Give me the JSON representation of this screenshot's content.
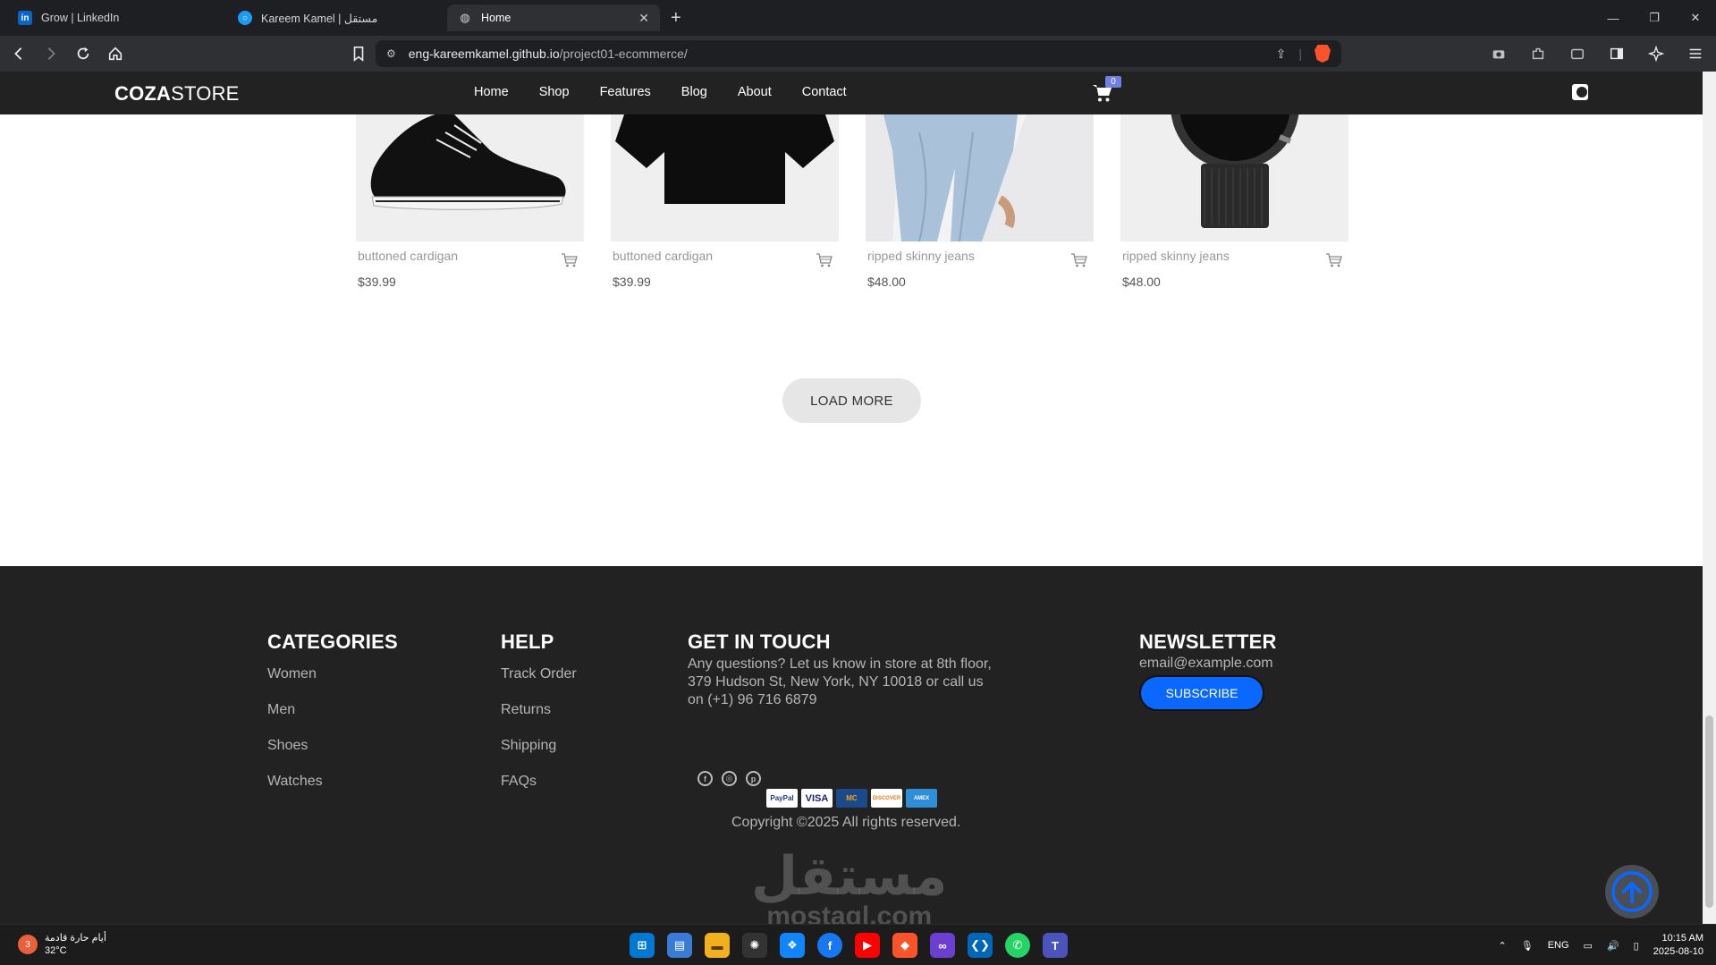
{
  "browser": {
    "tabs": [
      {
        "title": "Grow | LinkedIn",
        "icon": "linkedin-icon",
        "active": false
      },
      {
        "title": "Kareem Kamel | مستقل",
        "icon": "mostaql-icon",
        "active": false
      },
      {
        "title": "Home",
        "icon": "globe-icon",
        "active": true
      }
    ],
    "url_host": "eng-kareemkamel.github.io",
    "url_path": "/project01-ecommerce/"
  },
  "site": {
    "logo_bold": "COZA",
    "logo_rest": "STORE",
    "nav": [
      "Home",
      "Shop",
      "Features",
      "Blog",
      "About",
      "Contact"
    ],
    "cart_count": "0"
  },
  "products": [
    {
      "name": "buttoned cardigan",
      "price": "$39.99",
      "image": "sneaker"
    },
    {
      "name": "buttoned cardigan",
      "price": "$39.99",
      "image": "tshirt"
    },
    {
      "name": "ripped skinny jeans",
      "price": "$48.00",
      "image": "jeans"
    },
    {
      "name": "ripped skinny jeans",
      "price": "$48.00",
      "image": "watch"
    }
  ],
  "load_more": "LOAD MORE",
  "footer": {
    "categories": {
      "title": "CATEGORIES",
      "items": [
        "Women",
        "Men",
        "Shoes",
        "Watches"
      ]
    },
    "help": {
      "title": "HELP",
      "items": [
        "Track Order",
        "Returns",
        "Shipping",
        "FAQs"
      ]
    },
    "contact": {
      "title": "GET IN TOUCH",
      "text": "Any questions? Let us know in store at 8th floor, 379 Hudson St, New York, NY 10018 or call us on (+1) 96 716 6879"
    },
    "newsletter": {
      "title": "NEWSLETTER",
      "email": "email@example.com",
      "button": "SUBSCRIBE"
    },
    "payments": [
      "PayPal",
      "VISA",
      "MC",
      "DISCOVER",
      "AMEX"
    ],
    "copyright": "Copyright ©2025 All rights reserved."
  },
  "watermark": {
    "arabic": "مستقل",
    "latin": "mostaql.com"
  },
  "taskbar": {
    "weather_text": "أيام حارة قادمة",
    "weather_temp": "32°C",
    "weather_badge": "3",
    "lang": "ENG",
    "time": "10:15 AM",
    "date": "2025-08-10"
  }
}
